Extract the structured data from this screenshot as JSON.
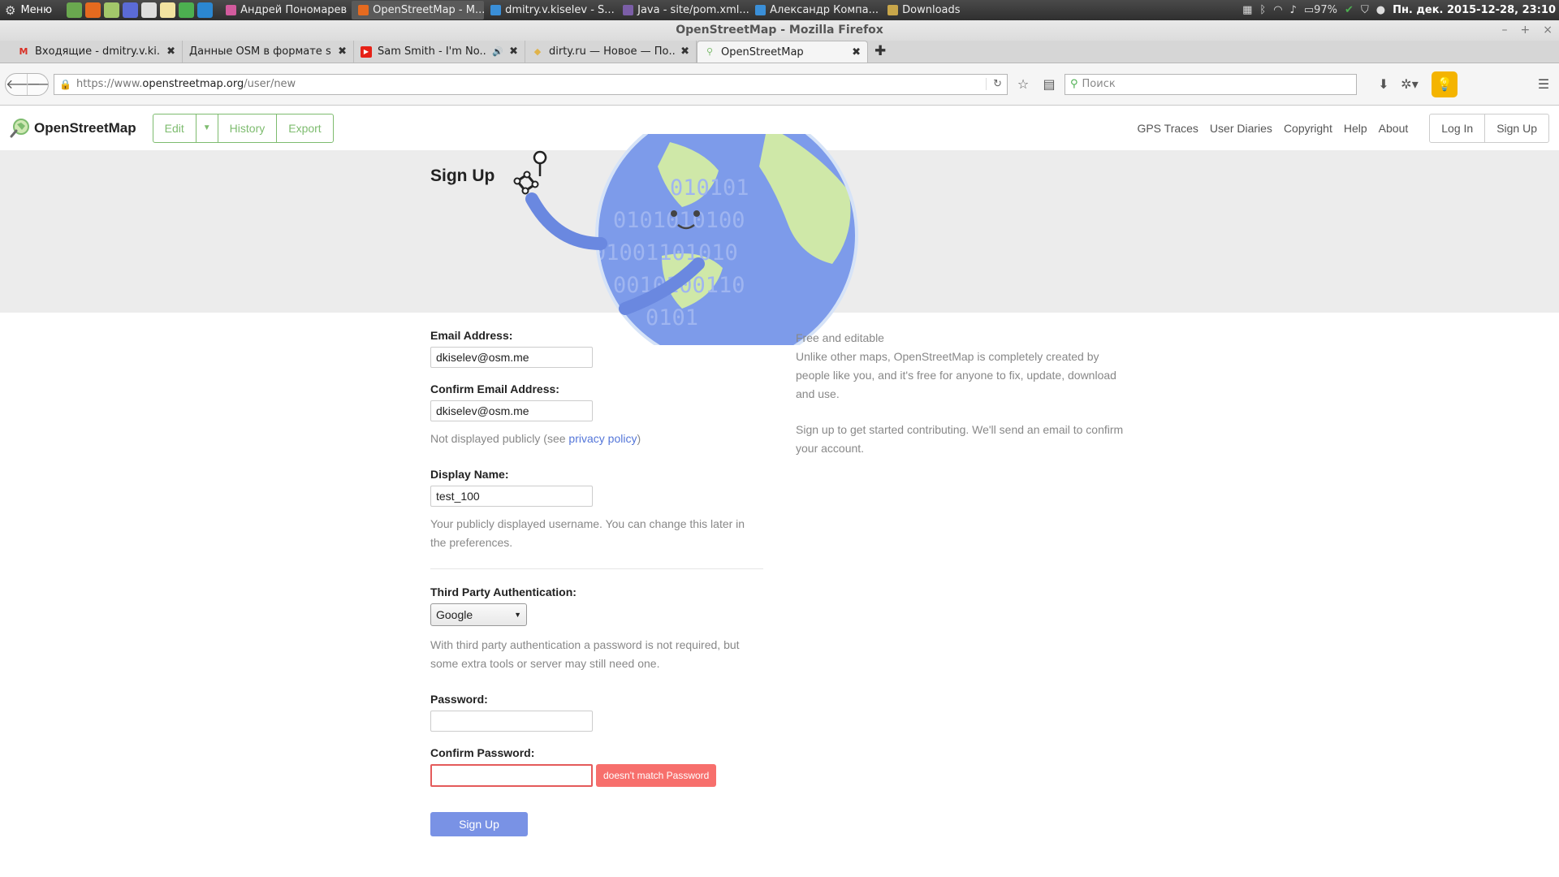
{
  "taskbar": {
    "menu_label": "Меню",
    "tasks": [
      {
        "title": "Андрей Пономарев",
        "color": "#d25b9d",
        "active": false
      },
      {
        "title": "OpenStreetMap - M...",
        "color": "#e56a1f",
        "active": true
      },
      {
        "title": "dmitry.v.kiselev - S...",
        "color": "#3a8fd8",
        "active": false
      },
      {
        "title": "Java - site/pom.xml...",
        "color": "#7b5ea7",
        "active": false
      },
      {
        "title": "Александр Компа...",
        "color": "#3a8fd8",
        "active": false
      },
      {
        "title": "Downloads",
        "color": "#c8a64a",
        "active": false
      }
    ],
    "battery": "97%",
    "clock": "Пн. дек. 2015-12-28, 23:10"
  },
  "window": {
    "title": "OpenStreetMap - Mozilla Firefox"
  },
  "tabs": [
    {
      "title": "Входящие - dmitry.v.ki...",
      "fav_color": "#d93025",
      "fav_glyph": "M"
    },
    {
      "title": "Данные OSM в формате s...",
      "fav_color": "",
      "fav_glyph": ""
    },
    {
      "title": "Sam Smith - I'm No...",
      "fav_color": "#e62117",
      "fav_glyph": "▶"
    },
    {
      "title": "dirty.ru — Новое — По...",
      "fav_color": "#e0b34a",
      "fav_glyph": "◆"
    },
    {
      "title": "OpenStreetMap",
      "fav_color": "#7ebc6f",
      "fav_glyph": "⚲"
    }
  ],
  "navbar": {
    "url_scheme": "https://www.",
    "url_host": "openstreetmap.org",
    "url_path": "/user/new",
    "search_placeholder": "Поиск"
  },
  "osm": {
    "logo_text": "OpenStreetMap",
    "edit_label": "Edit",
    "history_label": "History",
    "export_label": "Export",
    "links": [
      "GPS Traces",
      "User Diaries",
      "Copyright",
      "Help",
      "About"
    ],
    "login_label": "Log In",
    "signup_label": "Sign Up",
    "page_title": "Sign Up",
    "globe_digits": [
      "010101",
      "0101010100",
      "01001101010",
      "0010100110",
      "0101"
    ]
  },
  "form": {
    "email_label": "Email Address:",
    "email_value": "dkiselev@osm.me",
    "confirm_email_label": "Confirm Email Address:",
    "confirm_email_value": "dkiselev@osm.me",
    "privacy_prefix": "Not displayed publicly (see ",
    "privacy_link": "privacy policy",
    "privacy_suffix": ")",
    "display_name_label": "Display Name:",
    "display_name_value": "test_100",
    "display_name_help": "Your publicly displayed username. You can change this later in the preferences.",
    "third_party_label": "Third Party Authentication:",
    "third_party_selected": "Google",
    "third_party_help": "With third party authentication a password is not required, but some extra tools or server may still need one.",
    "password_label": "Password:",
    "password_value": "",
    "confirm_password_label": "Confirm Password:",
    "confirm_password_value": "",
    "password_error": "doesn't match Password",
    "submit_label": "Sign Up"
  },
  "sidebar": {
    "heading": "Free and editable",
    "body": "Unlike other maps, OpenStreetMap is completely created by people like you, and it's free for anyone to fix, update, download and use.",
    "cta": "Sign up to get started contributing. We'll send an email to confirm your account."
  },
  "colors": {
    "osm_green": "#7ebc6f",
    "link_blue": "#5476d9",
    "error_red": "#f76f6c",
    "submit_blue": "#7992e5"
  }
}
